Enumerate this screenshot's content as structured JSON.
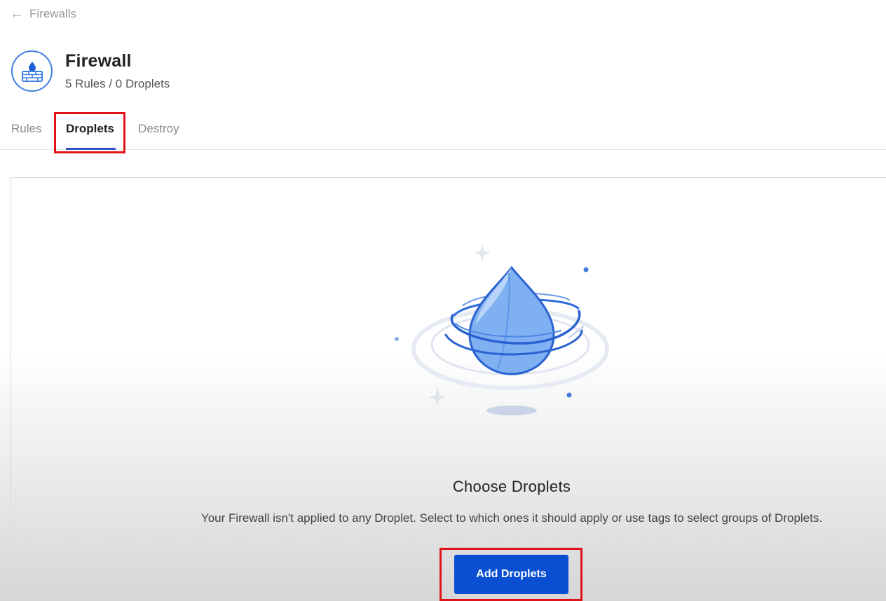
{
  "back_link": {
    "label": "Firewalls",
    "icon": "arrow-left-icon"
  },
  "header": {
    "title": "Firewall",
    "subtitle": "5 Rules / 0 Droplets",
    "icon": "firewall-icon",
    "accent_color": "#3f7fe0"
  },
  "tabs": [
    {
      "label": "Rules",
      "active": false
    },
    {
      "label": "Droplets",
      "active": true
    },
    {
      "label": "Destroy",
      "active": false
    }
  ],
  "empty_state": {
    "illustration": "droplet-illustration",
    "title": "Choose Droplets",
    "description": "Your Firewall isn't applied to any Droplet. Select to which ones it should apply or use tags to select groups of Droplets.",
    "button_label": "Add Droplets",
    "button_color": "#0a4fd1"
  },
  "highlight_color": "#e0121a"
}
